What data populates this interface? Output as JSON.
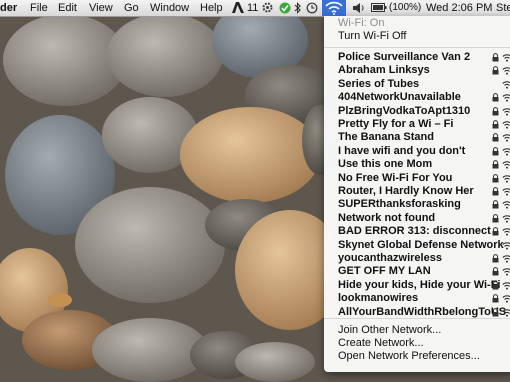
{
  "menubar": {
    "app_name_partial": "der",
    "menus": [
      "File",
      "Edit",
      "View",
      "Go",
      "Window",
      "Help"
    ],
    "adobe_badge": "11",
    "battery": "(100%)",
    "clock": "Wed 2:06 PM",
    "user_partial": "Ste"
  },
  "wifi_menu": {
    "status": "Wi-Fi: On",
    "toggle": "Turn Wi-Fi Off",
    "networks": [
      {
        "name": "Police Surveillance Van 2",
        "locked": true
      },
      {
        "name": "Abraham Linksys",
        "locked": true
      },
      {
        "name": "Series of Tubes",
        "locked": false
      },
      {
        "name": "404NetworkUnavailable",
        "locked": true
      },
      {
        "name": "PlzBringVodkaToApt1310",
        "locked": true
      },
      {
        "name": "Pretty Fly for a Wi – Fi",
        "locked": true
      },
      {
        "name": "The Banana Stand",
        "locked": true
      },
      {
        "name": "I have wifi and you don't",
        "locked": true
      },
      {
        "name": "Use this one Mom",
        "locked": true
      },
      {
        "name": "No Free Wi-Fi For You",
        "locked": true
      },
      {
        "name": "Router, I Hardly Know Her",
        "locked": true
      },
      {
        "name": "SUPERthanksforasking",
        "locked": true
      },
      {
        "name": "Network not found",
        "locked": true
      },
      {
        "name": "BAD ERROR 313: disconnect",
        "locked": true
      },
      {
        "name": "Skynet Global Defense Network",
        "locked": false
      },
      {
        "name": "youcanthazwireless",
        "locked": true
      },
      {
        "name": "GET OFF MY LAN",
        "locked": true
      },
      {
        "name": "Hide your kids, Hide your Wi-Fi",
        "locked": true
      },
      {
        "name": "lookmanowires",
        "locked": true
      },
      {
        "name": "AllYourBandWidthRbelongToUS",
        "locked": true
      }
    ],
    "actions": [
      "Join Other Network...",
      "Create Network...",
      "Open Network Preferences..."
    ]
  }
}
